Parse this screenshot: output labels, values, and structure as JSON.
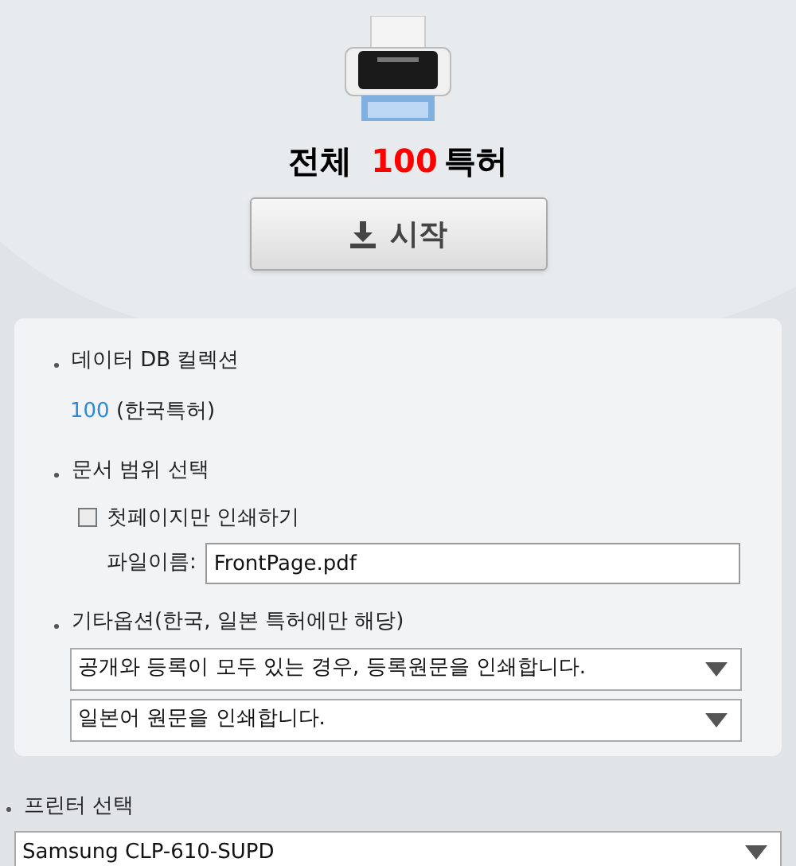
{
  "heading": {
    "prefix": "전체",
    "count": "100",
    "suffix": "특허"
  },
  "start_button": {
    "label": "시작"
  },
  "collection": {
    "label": "데이터 DB 컬렉션",
    "count": "100",
    "detail": "(한국특허)"
  },
  "range": {
    "label": "문서 범위 선택",
    "first_page_only": {
      "label": "첫페이지만 인쇄하기",
      "checked": false
    },
    "file_name": {
      "label": "파일이름:",
      "value": "FrontPage.pdf"
    }
  },
  "other_options": {
    "label": "기타옵션(한국, 일본 특허에만 해당)",
    "selects": [
      {
        "value": "공개와 등록이 모두 있는 경우, 등록원문을 인쇄합니다."
      },
      {
        "value": "일본어 원문을 인쇄합니다."
      }
    ]
  },
  "printer": {
    "label": "프린터 선택",
    "value": "Samsung CLP-610-SUPD"
  }
}
